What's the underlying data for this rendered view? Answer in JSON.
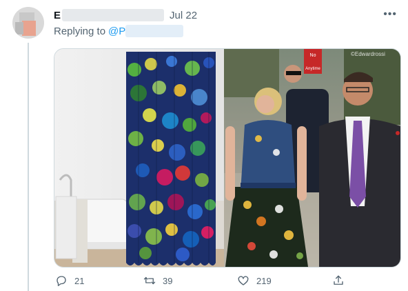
{
  "tweet": {
    "author_name": "E",
    "date": "Jul 22",
    "replying_prefix": "Replying to",
    "mention": "@P",
    "media_watermark": "©Edwardrossi",
    "sign_text_top": "No",
    "sign_text_bottom": "Anytime"
  },
  "actions": {
    "reply_count": "21",
    "retweet_count": "39",
    "like_count": "219"
  },
  "icons": {
    "more": "more-icon",
    "reply": "reply-icon",
    "retweet": "retweet-icon",
    "like": "heart-icon",
    "share": "share-icon"
  },
  "colors": {
    "link": "#1d9bf0",
    "muted": "#536471",
    "border": "#cfd9de"
  }
}
